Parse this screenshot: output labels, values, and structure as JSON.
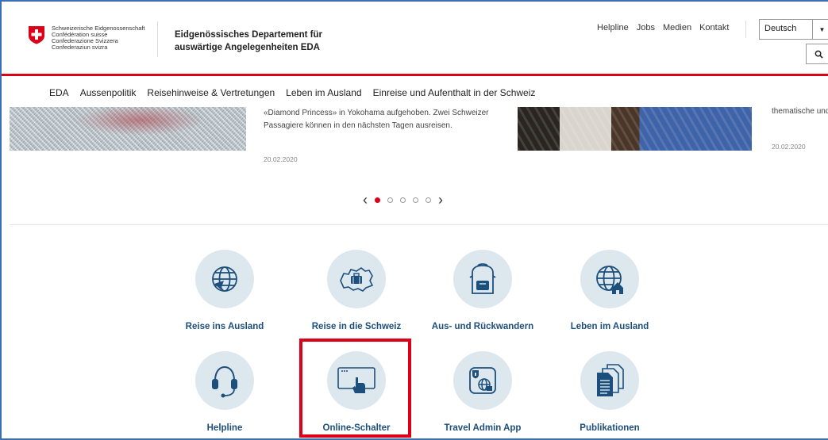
{
  "header": {
    "confederation_lines": [
      "Schweizerische Eidgenossenschaft",
      "Confédération suisse",
      "Confederazione Svizzera",
      "Confederaziun svizra"
    ],
    "department_line1": "Eidgenössisches Departement für",
    "department_line2": "auswärtige Angelegenheiten EDA",
    "top_links": [
      "Helpline",
      "Jobs",
      "Medien",
      "Kontakt"
    ],
    "language_selected": "Deutsch"
  },
  "nav": {
    "items": [
      "EDA",
      "Aussenpolitik",
      "Reisehinweise & Vertretungen",
      "Leben im Ausland",
      "Einreise und Aufenthalt in der Schweiz"
    ]
  },
  "carousel": {
    "article_text": "«Diamond Princess» in Yokohama aufgehoben. Zwei Schweizer Passagiere können in den nächsten Tagen ausreisen.",
    "article_date": "20.02.2020",
    "right_text": "thematische und",
    "right_date": "20.02.2020",
    "prev_arrow": "‹",
    "next_arrow": "›",
    "active_index": 1,
    "total": 5
  },
  "tiles": [
    {
      "label": "Reise ins Ausland",
      "icon": "globe-plane-icon"
    },
    {
      "label": "Reise in die Schweiz",
      "icon": "switzerland-map-suitcase-icon"
    },
    {
      "label": "Aus- und Rückwandern",
      "icon": "backpack-icon"
    },
    {
      "label": "Leben im Ausland",
      "icon": "globe-house-icon"
    },
    {
      "label": "Helpline",
      "icon": "headset-icon"
    },
    {
      "label": "Online-Schalter",
      "icon": "browser-pointer-icon"
    },
    {
      "label": "Travel Admin App",
      "icon": "app-shield-globe-icon"
    },
    {
      "label": "Publikationen",
      "icon": "documents-icon"
    }
  ],
  "colors": {
    "accent_red": "#dc0018",
    "tile_label_blue": "#1d4f7c",
    "tile_circle": "#dde8ee",
    "frame_blue": "#3c6eb4"
  }
}
